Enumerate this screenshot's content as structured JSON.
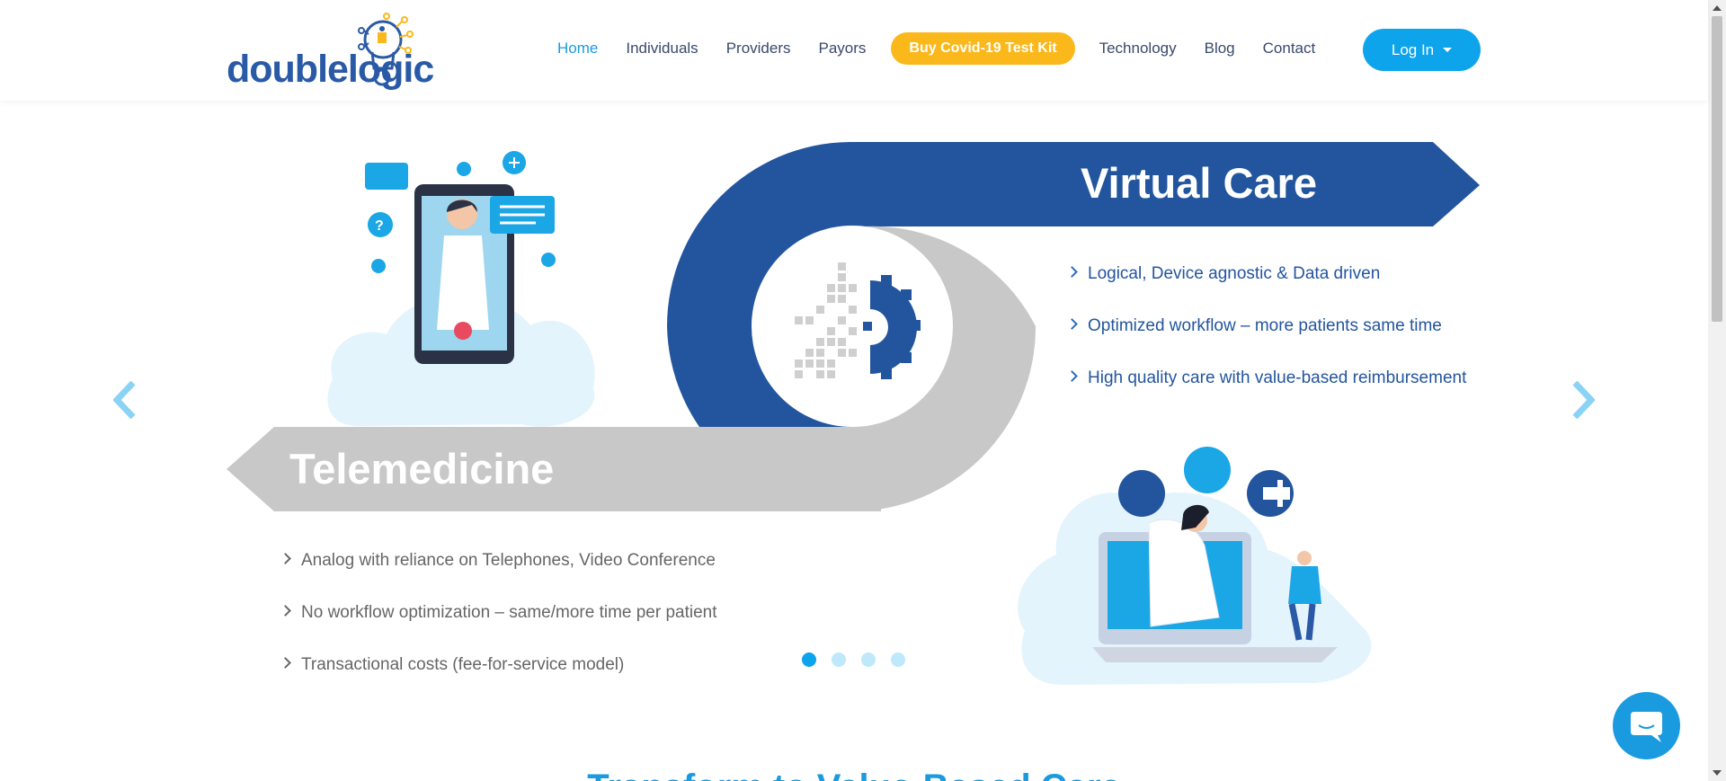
{
  "brand": {
    "logo_text": "doublelogic"
  },
  "nav": {
    "items": [
      {
        "label": "Home",
        "active": true
      },
      {
        "label": "Individuals"
      },
      {
        "label": "Providers"
      },
      {
        "label": "Payors"
      },
      {
        "label": "Buy Covid-19 Test Kit",
        "cta": true
      },
      {
        "label": "Technology"
      },
      {
        "label": "Blog"
      },
      {
        "label": "Contact"
      }
    ],
    "login_label": "Log In"
  },
  "hero": {
    "virtual_care": {
      "title": "Virtual Care",
      "bullets": [
        "Logical, Device agnostic & Data driven",
        "Optimized workflow – more patients same time",
        "High quality care with value-based reimbursement"
      ]
    },
    "telemedicine": {
      "title": "Telemedicine",
      "bullets": [
        "Analog with reliance on Telephones, Video Conference",
        "No workflow optimization – same/more time per patient",
        "Transactional costs (fee-for-service model)"
      ]
    },
    "slides_count": 4,
    "active_slide": 1
  },
  "next_section": {
    "heading": "Transform to Value-Based Care"
  },
  "colors": {
    "primary_blue": "#23559e",
    "accent_blue": "#0ea4ec",
    "cta_yellow": "#fbb81b",
    "grey": "#c8c8c8"
  }
}
